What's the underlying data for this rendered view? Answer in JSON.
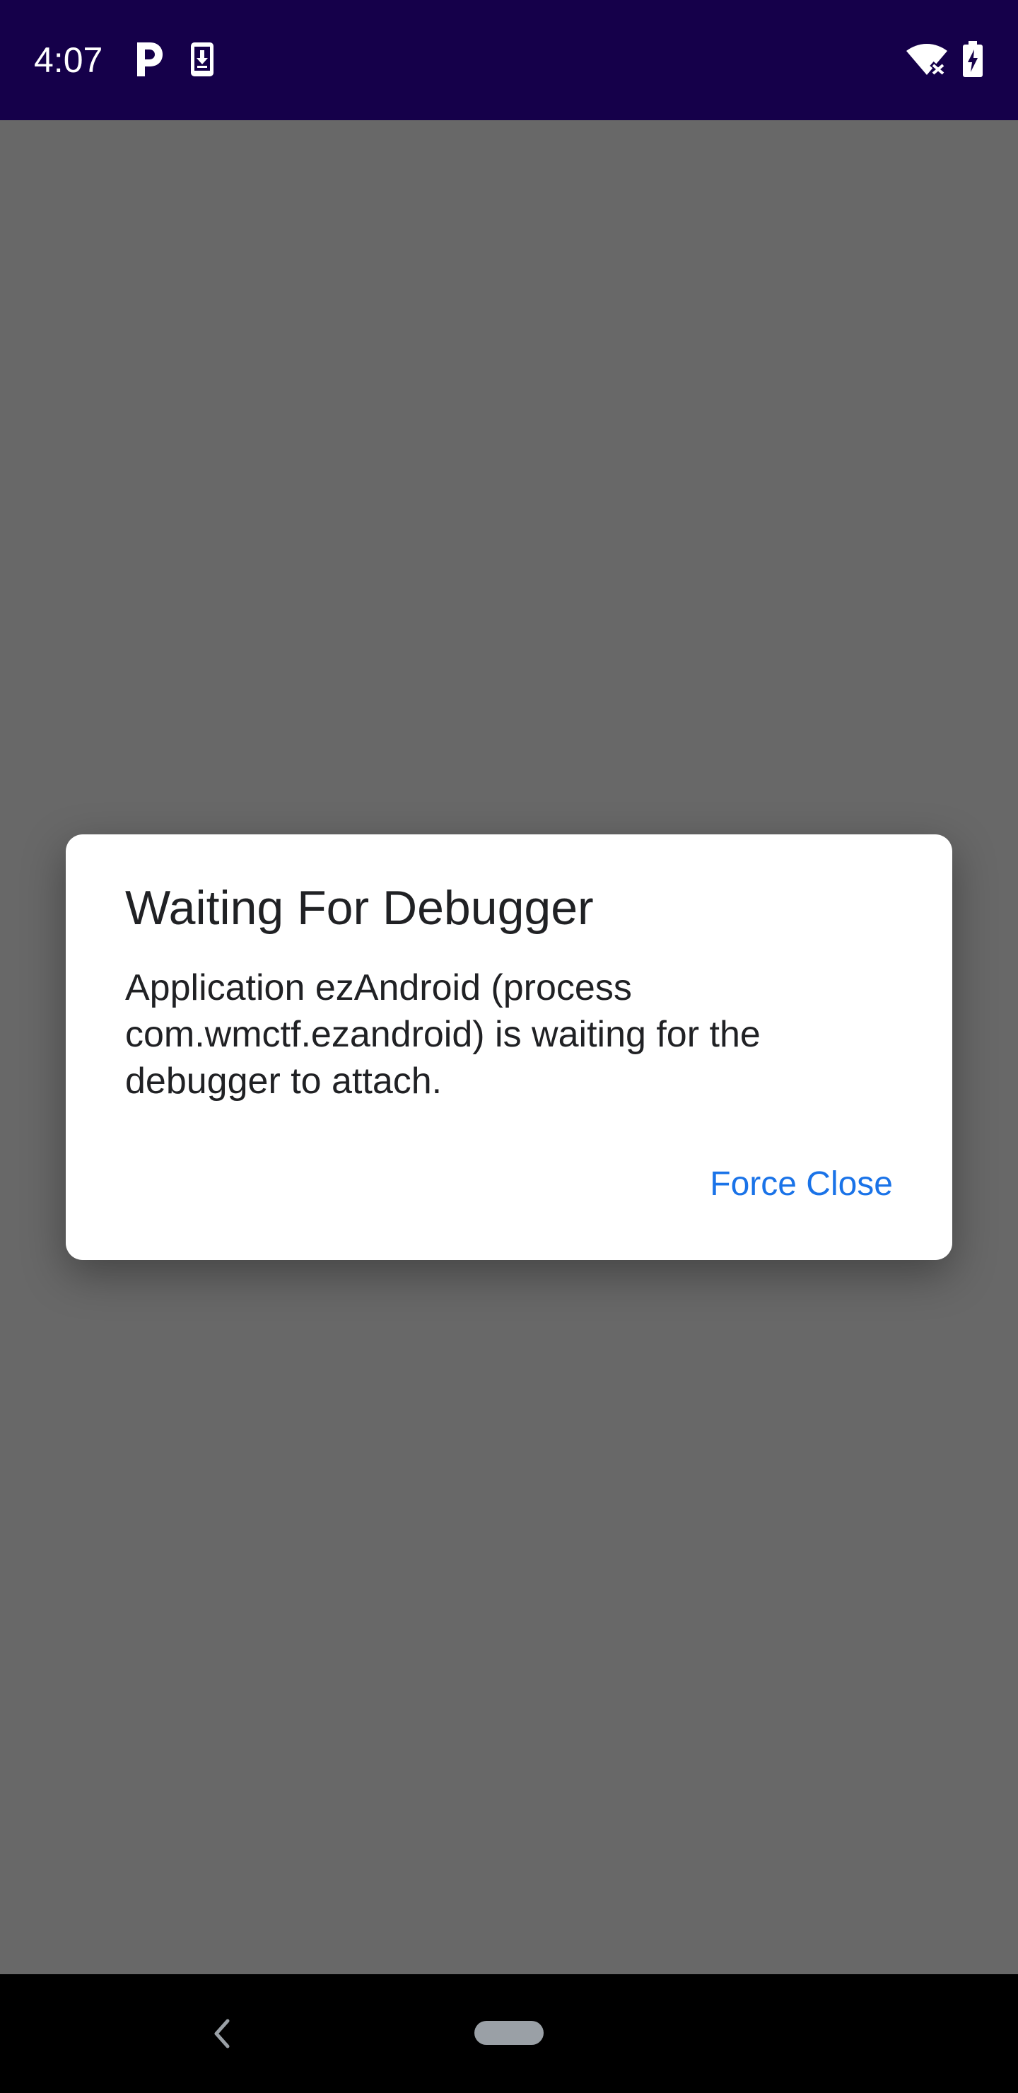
{
  "status_bar": {
    "time": "4:07",
    "icons": [
      "parking-icon",
      "download-icon",
      "wifi-off-icon",
      "battery-charging-icon"
    ],
    "background_color": "#15004a"
  },
  "dialog": {
    "title": "Waiting For Debugger",
    "message": "Application ezAndroid (process com.wmctf.ezandroid) is waiting for the debugger to attach.",
    "force_close_label": "Force Close",
    "accent_color": "#1a73e8"
  },
  "navigation_bar": {
    "icons": [
      "back-icon",
      "home-pill-icon"
    ]
  },
  "colors": {
    "scrim": "#686868",
    "dialog_background": "#ffffff",
    "nav_background": "#000000"
  }
}
